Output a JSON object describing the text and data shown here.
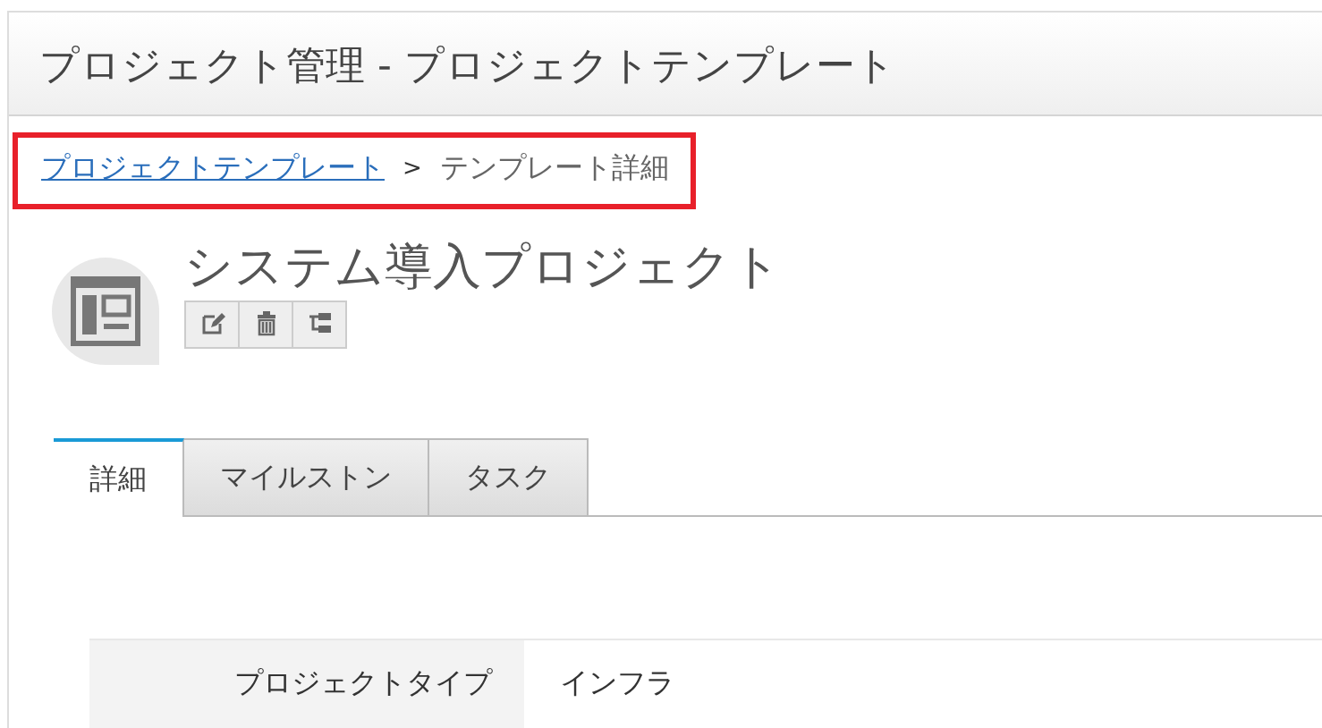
{
  "header": {
    "title": "プロジェクト管理 - プロジェクトテンプレート"
  },
  "breadcrumb": {
    "highlighted": true,
    "items": [
      {
        "label": "プロジェクトテンプレート",
        "kind": "link"
      },
      {
        "label": ">",
        "kind": "separator"
      },
      {
        "label": "テンプレート詳細",
        "kind": "current"
      }
    ]
  },
  "project": {
    "name": "システム導入プロジェクト",
    "actions": [
      {
        "kind": "edit"
      },
      {
        "kind": "delete"
      },
      {
        "kind": "structure"
      }
    ]
  },
  "tabs": [
    {
      "label": "詳細",
      "selected": true
    },
    {
      "label": "マイルストン",
      "selected": false
    },
    {
      "label": "タスク",
      "selected": false
    }
  ],
  "details": [
    {
      "label": "プロジェクトタイプ",
      "value": "インフラ"
    }
  ]
}
